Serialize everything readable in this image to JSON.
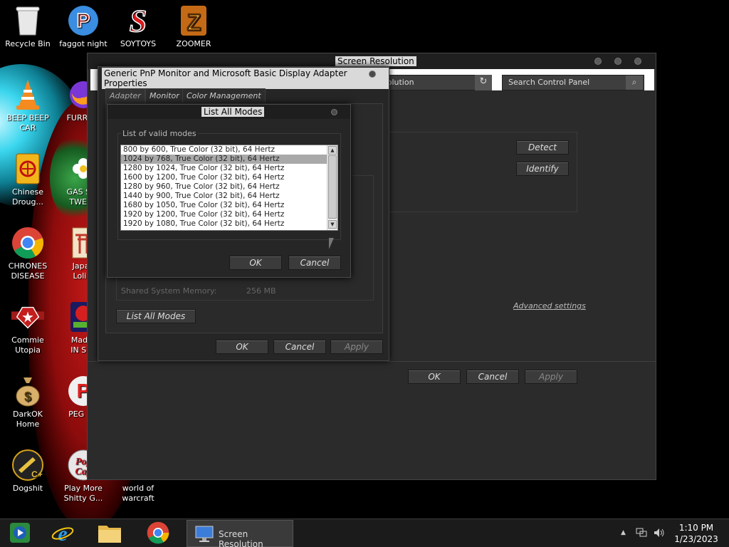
{
  "desktop": {
    "icons": [
      {
        "label": "Recycle Bin",
        "icon": "recycle-bin-icon"
      },
      {
        "label": "faggot night",
        "icon": "app-p-icon"
      },
      {
        "label": "SOYTOYS",
        "icon": "app-s-icon"
      },
      {
        "label": "ZOOMER",
        "icon": "app-z-icon"
      },
      {
        "label": "BEEP BEEP CAR",
        "icon": "vlc-cone-icon"
      },
      {
        "label": "FURRY C",
        "icon": "firefox-icon"
      },
      {
        "label": "Chinese Droug...",
        "icon": "mahjong-icon"
      },
      {
        "label": "GAS STA TWEAK",
        "icon": "flower-app-icon"
      },
      {
        "label": "CHRONES DISEASE",
        "icon": "chrome-icon"
      },
      {
        "label": "Japan Loli P",
        "icon": "torii-icon"
      },
      {
        "label": "Commie Utopia",
        "icon": "commie-emblem-icon"
      },
      {
        "label": "Mad A IN SPA",
        "icon": "angry-bird-icon"
      },
      {
        "label": "DarkOK Home",
        "icon": "money-bag-icon"
      },
      {
        "label": "PEG MY",
        "icon": "peg-app-icon"
      },
      {
        "label": "Dogshit",
        "icon": "game-plus-icon"
      },
      {
        "label": "Play More Shitty G...",
        "icon": "popcap-icon"
      },
      {
        "label": "world of warcraft",
        "icon": "wow-icon"
      }
    ]
  },
  "screen_resolution_window": {
    "title": "Screen Resolution",
    "address_text": "solution",
    "search_placeholder": "Search Control Panel",
    "detect_label": "Detect",
    "identify_label": "Identify",
    "advanced_settings_label": "Advanced settings",
    "ok_label": "OK",
    "cancel_label": "Cancel",
    "apply_label": "Apply"
  },
  "properties_dialog": {
    "title": "Generic PnP Monitor and Microsoft Basic Display Adapter Properties",
    "tabs": [
      {
        "label": "Adapter"
      },
      {
        "label": "Monitor"
      },
      {
        "label": "Color Management"
      }
    ],
    "shared_memory_label": "Shared System Memory:",
    "shared_memory_value": "256 MB",
    "list_all_modes_label": "List All Modes",
    "ok_label": "OK",
    "cancel_label": "Cancel",
    "apply_label": "Apply"
  },
  "list_modes_dialog": {
    "title": "List All Modes",
    "group_label": "List of valid modes",
    "modes": [
      "800 by 600, True Color (32 bit), 64 Hertz",
      "1024 by 768, True Color (32 bit), 64 Hertz",
      "1280 by 1024, True Color (32 bit), 64 Hertz",
      "1600 by 1200, True Color (32 bit), 64 Hertz",
      "1280 by 960, True Color (32 bit), 64 Hertz",
      "1440 by 900, True Color (32 bit), 64 Hertz",
      "1680 by 1050, True Color (32 bit), 64 Hertz",
      "1920 by 1200, True Color (32 bit), 64 Hertz",
      "1920 by 1080, True Color (32 bit), 64 Hertz"
    ],
    "selected_index": 1,
    "ok_label": "OK",
    "cancel_label": "Cancel"
  },
  "taskbar": {
    "pinned": [
      {
        "icon": "media-center-icon"
      },
      {
        "icon": "internet-explorer-icon"
      },
      {
        "icon": "file-explorer-icon"
      },
      {
        "icon": "chrome-icon"
      }
    ],
    "active_task_label": "Screen Resolution",
    "time": "1:10 PM",
    "date": "1/23/2023"
  },
  "colors": {
    "window_bg": "#2b2b2b",
    "titlebar_bg": "#1f1f1f",
    "selection": "#a9a9a9",
    "taskbar_bg": "#1b1b1b"
  }
}
